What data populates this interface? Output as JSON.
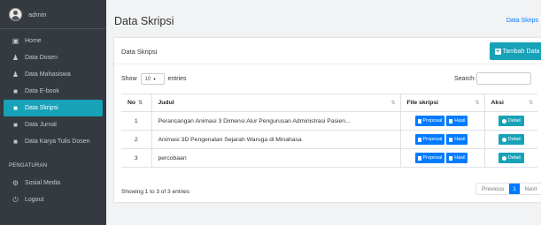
{
  "user": {
    "name": "admin"
  },
  "sidebar": {
    "items": [
      {
        "label": "Home",
        "icon": "dashboard-icon"
      },
      {
        "label": "Data Dosen",
        "icon": "user-icon"
      },
      {
        "label": "Data Mahasiswa",
        "icon": "users-icon"
      },
      {
        "label": "Data E-book",
        "icon": "book-icon"
      },
      {
        "label": "Data Skripsi",
        "icon": "book-icon"
      },
      {
        "label": "Data Jurnal",
        "icon": "book-icon"
      },
      {
        "label": "Data Karya Tulis Dosen",
        "icon": "book-icon"
      }
    ],
    "section_header": "PENGATURAN",
    "settings_items": [
      {
        "label": "Sosial Media",
        "icon": "gear-icon"
      },
      {
        "label": "Logout",
        "icon": "power-icon"
      }
    ]
  },
  "header": {
    "title": "Data Skripsi",
    "breadcrumb": "Data Skrips"
  },
  "card": {
    "title": "Data Skripsi",
    "add_button": "Tambah Data",
    "show_label": "Show",
    "entries_value": "10",
    "entries_label": "entries",
    "search_label": "Search:"
  },
  "table": {
    "headers": {
      "no": "No",
      "judul": "Judul",
      "file": "File skripsi",
      "aksi": "Aksi"
    },
    "rows": [
      {
        "no": "1",
        "judul": "Perancangan Animasi 3 Dimensi Alur Pengurusan Administrasi Pasien..."
      },
      {
        "no": "2",
        "judul": "Animasi 3D Pengenalan Sejarah Waruga di Minahasa"
      },
      {
        "no": "3",
        "judul": "percobaan"
      }
    ],
    "proposal_label": "Proposal",
    "hasil_label": "Hasil",
    "detail_label": "Detail"
  },
  "footer": {
    "showing": "Showing 1 to 3 of 3 entries",
    "previous": "Previous",
    "page": "1",
    "next": "Next"
  },
  "colors": {
    "sidebar": "#343a40",
    "accent": "#17a2b8",
    "primary": "#007bff"
  }
}
